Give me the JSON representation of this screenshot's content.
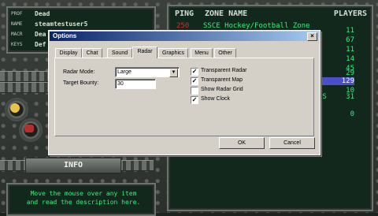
{
  "profile": {
    "rows": [
      {
        "label": "PROF",
        "value": "Dead"
      },
      {
        "label": "NAME",
        "value": "steamtestuser5"
      },
      {
        "label": "MACR",
        "value": "Dea"
      },
      {
        "label": "KEYS",
        "value": "Def"
      }
    ]
  },
  "zone_list": {
    "headers": {
      "ping": "PING",
      "zone_name": "ZONE NAME",
      "players": "PLAYERS"
    },
    "first_row": {
      "ping": "250",
      "name": "SSCE Hockey/Football Zone"
    },
    "partial_row": "US",
    "players": [
      "11",
      "67",
      "11",
      "14",
      "45",
      "29",
      "129",
      "10",
      "31",
      "0"
    ]
  },
  "info": {
    "banner": "INFO",
    "text": "Move the mouse over any item and read the description here."
  },
  "dialog": {
    "title": "Options",
    "close_glyph": "×",
    "tabs": [
      "Display",
      "Chat",
      "Sound",
      "Radar",
      "Graphics",
      "Menu",
      "Other"
    ],
    "active_tab": "Radar",
    "radar_mode_label": "Radar Mode:",
    "radar_mode_value": "Large",
    "dropdown_glyph": "▼",
    "target_bounty_label": "Target Bounty:",
    "target_bounty_value": "30",
    "checkboxes": [
      {
        "label": "Transparent Radar",
        "checked": true
      },
      {
        "label": "Transparent Map",
        "checked": true
      },
      {
        "label": "Show Radar Grid",
        "checked": false
      },
      {
        "label": "Show Clock",
        "checked": true
      }
    ],
    "ok_label": "OK",
    "cancel_label": "Cancel",
    "check_glyph": "✓"
  },
  "colors": {
    "text_green": "#2df27c",
    "titlebar": "#0a246a",
    "dialog_bg": "#d4d0c8"
  }
}
